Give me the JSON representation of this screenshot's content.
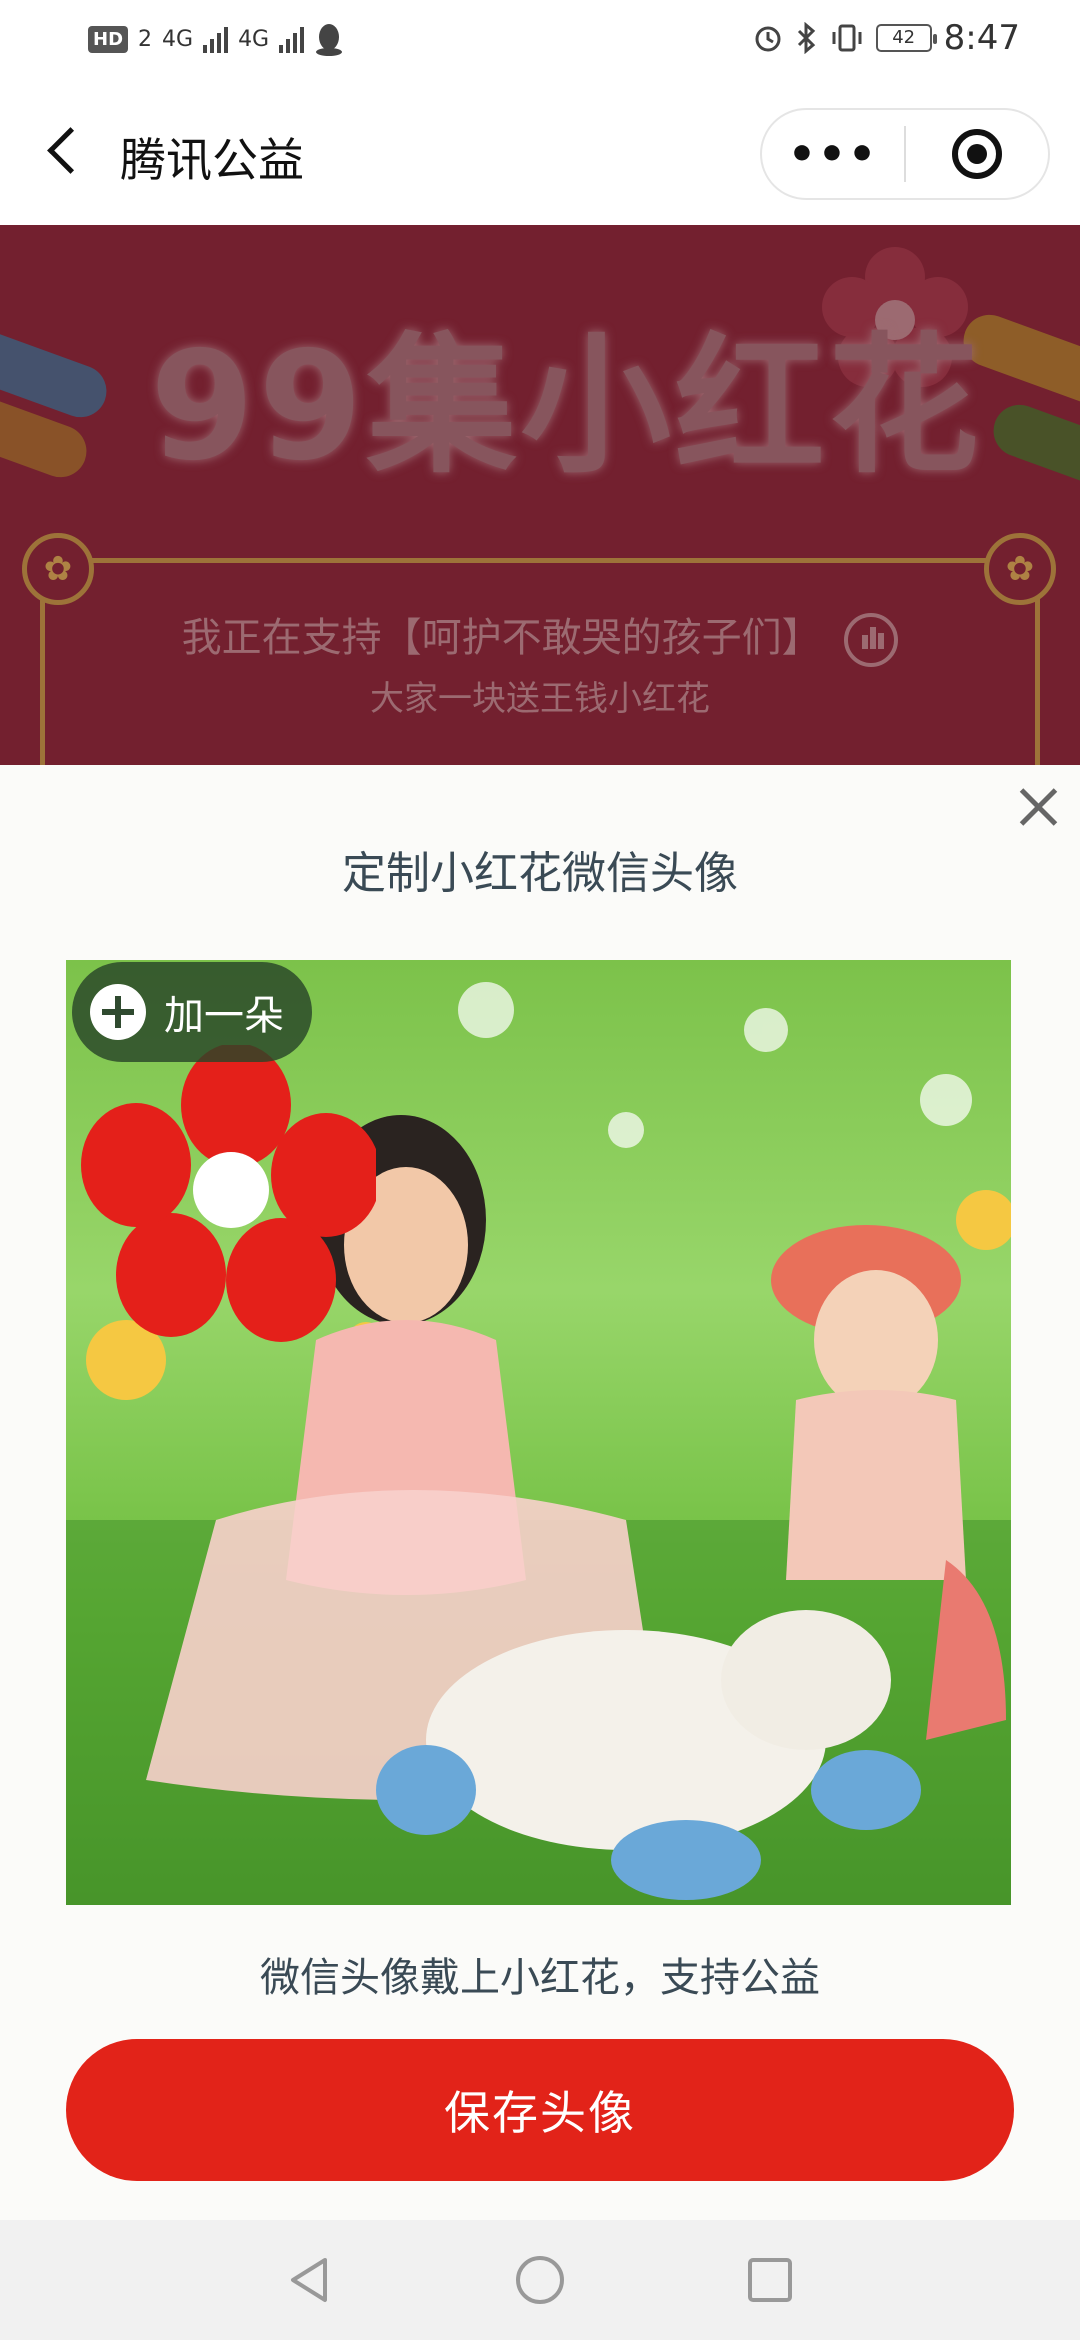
{
  "status_bar": {
    "hd_label": "HD",
    "hd_sub": "2",
    "net1": "4G",
    "net2": "4G",
    "battery": "42",
    "time": "8:47"
  },
  "header": {
    "title": "腾讯公益",
    "more_label": "•••"
  },
  "banner": {
    "title": "99集小红花",
    "line1": "我正在支持【呵护不敢哭的孩子们】",
    "line2": "大家一块送王钱小红花",
    "colors": {
      "background": "#7a2232",
      "frame": "#a67a3d"
    }
  },
  "sheet": {
    "title": "定制小红花微信头像",
    "add_label": "加一朵",
    "caption": "微信头像戴上小红花，支持公益",
    "save_label": "保存头像",
    "accent": "#e22319"
  },
  "icons": [
    "back-arrow-icon",
    "more-dots-icon",
    "target-close-icon",
    "bar-chart-icon",
    "gear-icon",
    "close-icon",
    "plus-icon",
    "red-flower-icon",
    "nav-back-icon",
    "nav-home-icon",
    "nav-recent-icon"
  ]
}
